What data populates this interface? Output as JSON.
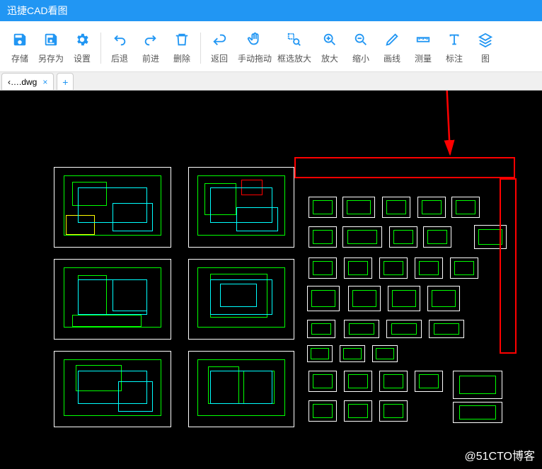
{
  "titlebar": {
    "title": "迅捷CAD看图"
  },
  "toolbar": {
    "save": "存储",
    "saveAs": "另存为",
    "settings": "设置",
    "back": "后退",
    "forward": "前进",
    "delete": "删除",
    "return": "返回",
    "pan": "手动拖动",
    "zoomWindow": "框选放大",
    "zoomIn": "放大",
    "zoomOut": "缩小",
    "line": "画线",
    "measure": "测量",
    "annotate": "标注",
    "image": "图"
  },
  "tab": {
    "filename": "‹….dwg",
    "add": "+"
  },
  "watermark": "@51CTO博客"
}
